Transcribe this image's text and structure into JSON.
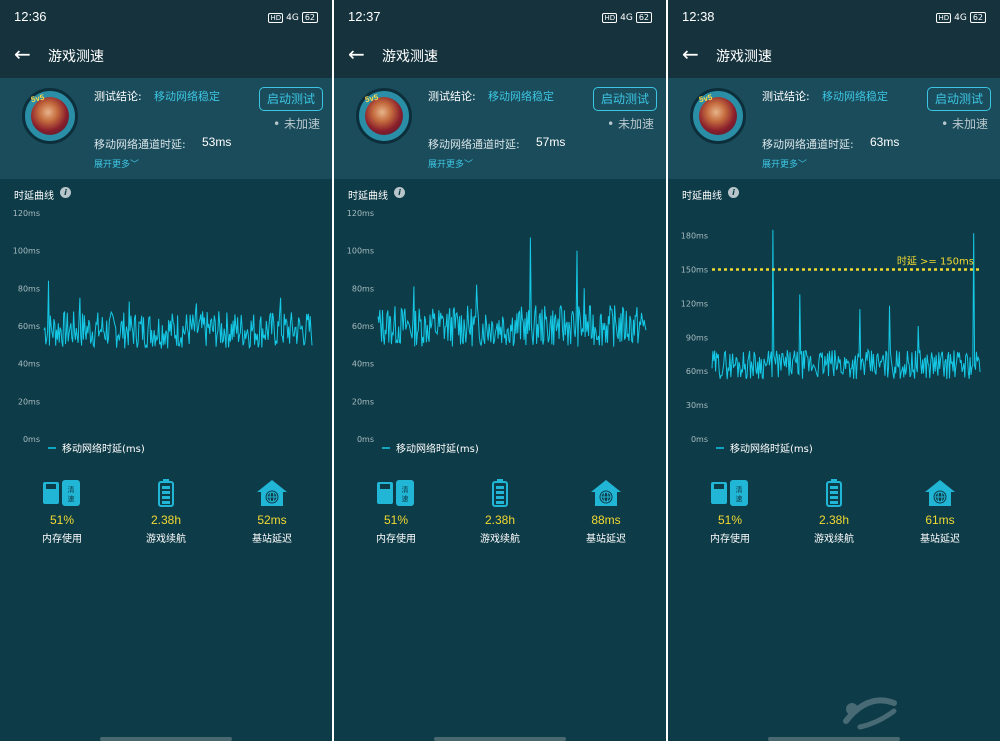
{
  "common": {
    "nav_title": "游戏测速",
    "conclusion_label": "测试结论:",
    "conclusion_value": "移动网络稳定",
    "start_button": "启动测试",
    "accel_status": "• 未加速",
    "latency_label": "移动网络通道时延:",
    "show_more": "展开更多",
    "chart_title": "时延曲线",
    "legend": "移动网络时延(ms)",
    "status_hd": "HD",
    "status_signal": "4G",
    "status_battery": "62",
    "avatar_tag": "5v5",
    "metric_labels": [
      "内存使用",
      "游戏续航",
      "基站延迟"
    ],
    "icon_memory_badge": "清速"
  },
  "panels": [
    {
      "time": "12:36",
      "channel_latency": "53ms",
      "memory": "51%",
      "battery_life": "2.38h",
      "base_station": "52ms"
    },
    {
      "time": "12:37",
      "channel_latency": "57ms",
      "memory": "51%",
      "battery_life": "2.38h",
      "base_station": "88ms"
    },
    {
      "time": "12:38",
      "channel_latency": "63ms",
      "memory": "51%",
      "battery_life": "2.38h",
      "base_station": "61ms"
    }
  ],
  "chart_data": [
    {
      "type": "line",
      "ylim": [
        0,
        120
      ],
      "yticks": [
        0,
        20,
        40,
        60,
        80,
        100,
        120
      ],
      "ytick_labels": [
        "0ms",
        "20ms",
        "40ms",
        "60ms",
        "80ms",
        "100ms",
        "120ms"
      ],
      "series": [
        {
          "name": "移动网络时延(ms)",
          "color": "#15c9e6",
          "base": 58,
          "noise": 10,
          "min": 47,
          "max": 70,
          "spikes": [
            [
              5,
              84
            ],
            [
              40,
              75
            ],
            [
              95,
              73
            ],
            [
              170,
              72
            ],
            [
              264,
              75
            ]
          ],
          "seed": 7,
          "count": 300
        }
      ]
    },
    {
      "type": "line",
      "ylim": [
        0,
        120
      ],
      "yticks": [
        0,
        20,
        40,
        60,
        80,
        100,
        120
      ],
      "ytick_labels": [
        "0ms",
        "20ms",
        "40ms",
        "60ms",
        "80ms",
        "100ms",
        "120ms"
      ],
      "series": [
        {
          "name": "移动网络时延(ms)",
          "color": "#15c9e6",
          "base": 60,
          "noise": 11,
          "min": 48,
          "max": 76,
          "spikes": [
            [
              170,
              107
            ],
            [
              222,
              100
            ],
            [
              110,
              82
            ],
            [
              40,
              81
            ],
            [
              230,
              80
            ]
          ],
          "seed": 13,
          "count": 300
        }
      ]
    },
    {
      "type": "line",
      "ylim": [
        0,
        200
      ],
      "yticks": [
        0,
        30,
        60,
        90,
        120,
        150,
        180
      ],
      "ytick_labels": [
        "0ms",
        "30ms",
        "60ms",
        "90ms",
        "120ms",
        "150ms",
        "180ms"
      ],
      "threshold": {
        "value": 150,
        "label": "时延 >= 150ms",
        "color": "#f1d932"
      },
      "series": [
        {
          "name": "移动网络时延(ms)",
          "color": "#15c9e6",
          "base": 66,
          "noise": 13,
          "min": 48,
          "max": 82,
          "spikes": [
            [
              68,
              185
            ],
            [
              98,
              128
            ],
            [
              165,
              115
            ],
            [
              198,
              118
            ],
            [
              230,
              100
            ],
            [
              292,
              182
            ]
          ],
          "seed": 29,
          "count": 300
        }
      ]
    }
  ]
}
